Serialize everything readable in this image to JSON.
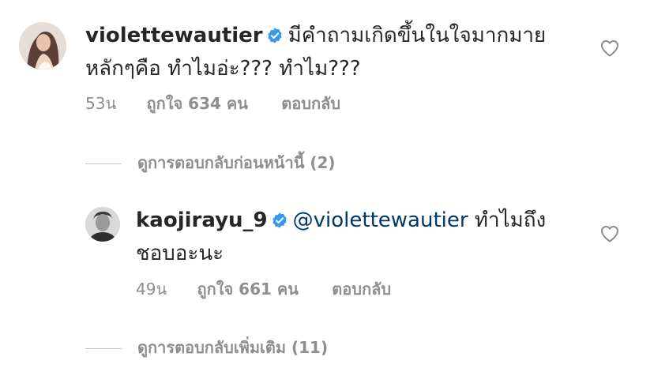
{
  "comments": [
    {
      "username": "violettewautier",
      "verified": true,
      "text_line1": "มีคำถามเกิดขึ้นในใจมากมาย",
      "text_line2": "หลักๆคือ ทำไมอ่ะ??? ทำไม???",
      "time": "53น",
      "likes": "ถูกใจ 634 คน",
      "reply_label": "ตอบกลับ",
      "view_replies": "ดูการตอบกลับก่อนหน้านี้ (2)"
    },
    {
      "username": "kaojirayu_9",
      "verified": true,
      "mention": "@violettewautier",
      "text_line1_rest": " ทำไมถึง",
      "text_line2": "ชอบอะนะ",
      "time": "49น",
      "likes": "ถูกใจ 661 คน",
      "reply_label": "ตอบกลับ",
      "view_replies": "ดูการตอบกลับเพิ่มเติม (11)"
    }
  ],
  "icons": {
    "verified": "verified-badge-icon",
    "like": "heart-outline-icon"
  },
  "colors": {
    "verified": "#3897f0",
    "text": "#262626",
    "meta": "#8e8e8e",
    "mention": "#00376b"
  }
}
